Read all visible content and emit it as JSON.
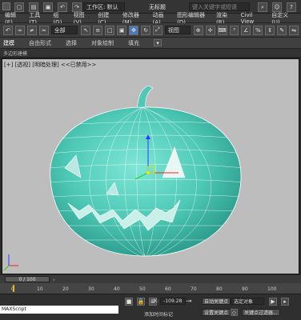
{
  "titlebar": {
    "workspace_label": "工作区: 默认",
    "doc_title": "无标题",
    "search_placeholder": "键入关键字或短语"
  },
  "menubar": {
    "items": [
      "编辑(E)",
      "工具(T)",
      "组(G)",
      "视图(V)",
      "创建(C)",
      "修改器(M)",
      "动画(A)",
      "图形编辑器(D)",
      "渲染(R)",
      "Civil View",
      "自定义(U)"
    ]
  },
  "toolbar": {
    "filter_value": "全部",
    "ref_coord_value": "视图"
  },
  "ribbon": {
    "tabs": [
      "建模",
      "自由形式",
      "选择",
      "对象绘制",
      "填充"
    ],
    "sub_label": "多边形建模"
  },
  "viewport": {
    "label": "[+] [透视] [明暗处理] <<已禁用>>"
  },
  "timeline": {
    "frame_label": "0 / 100",
    "ticks": [
      "0",
      "10",
      "20",
      "30",
      "40",
      "50",
      "60",
      "70",
      "80",
      "90",
      "100"
    ]
  },
  "status": {
    "maxscript_label": "MAXScript",
    "x_label": "X:",
    "x_value": "-109.28",
    "add_tag_label": "添加时间标记",
    "auto_key_label": "自动关键点",
    "set_key_label": "设置关键点",
    "select_combo": "选定对象",
    "filter_label": "关键点过滤器..."
  },
  "colors": {
    "pumpkin": "#5fd3c0",
    "wire": "#ffffff",
    "viewport_bg": "#bdbdbd",
    "timeline_marker": "#e2b600"
  }
}
